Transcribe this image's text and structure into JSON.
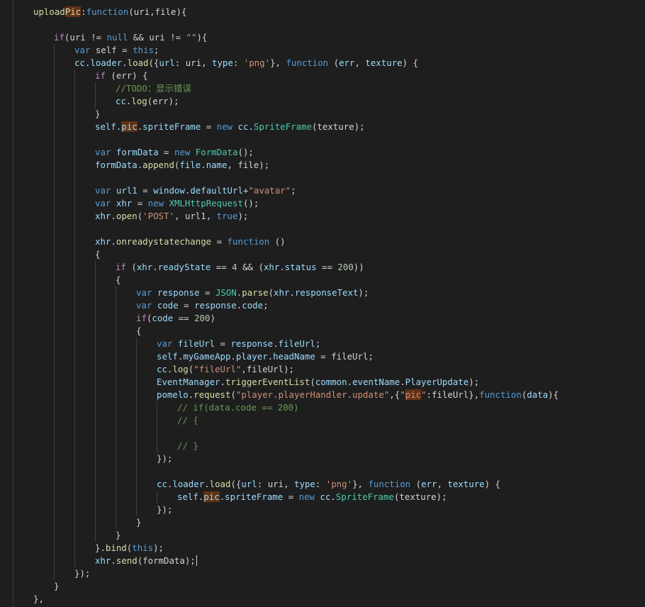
{
  "editor": {
    "theme_colors": {
      "background": "#1e1e1e",
      "keyword": "#569cd6",
      "control": "#c586c0",
      "function": "#dcdcaa",
      "string": "#ce9178",
      "number": "#b5cea8",
      "variable": "#9cdcfe",
      "type": "#4ec9b0",
      "comment": "#6a9955",
      "match_highlight": "#613214"
    },
    "current_line": 44,
    "lines": [
      [
        [
          "fn",
          "upload"
        ],
        [
          "fn hl",
          "Pic"
        ],
        [
          "pl",
          ":"
        ],
        [
          "kw",
          "function"
        ],
        [
          "pl",
          "(uri,file){"
        ]
      ],
      [],
      [
        [
          "ctl",
          "if"
        ],
        [
          "pl",
          "(uri != "
        ],
        [
          "kw",
          "null"
        ],
        [
          "pl",
          " && uri != "
        ],
        [
          "str",
          "\"\""
        ],
        [
          "pl",
          "){"
        ]
      ],
      [
        [
          "kw",
          "var"
        ],
        [
          "pl",
          " self = "
        ],
        [
          "kw",
          "this"
        ],
        [
          "pl",
          ";"
        ]
      ],
      [
        [
          "var",
          "cc"
        ],
        [
          "pl",
          "."
        ],
        [
          "var",
          "loader"
        ],
        [
          "pl",
          "."
        ],
        [
          "fn",
          "load"
        ],
        [
          "pl",
          "({"
        ],
        [
          "var",
          "url"
        ],
        [
          "pl",
          ": uri, "
        ],
        [
          "var",
          "type"
        ],
        [
          "pl",
          ": "
        ],
        [
          "str",
          "'png'"
        ],
        [
          "pl",
          "}, "
        ],
        [
          "kw",
          "function"
        ],
        [
          "pl",
          " ("
        ],
        [
          "var",
          "err"
        ],
        [
          "pl",
          ", "
        ],
        [
          "var",
          "texture"
        ],
        [
          "pl",
          ") {"
        ]
      ],
      [
        [
          "ctl",
          "if"
        ],
        [
          "pl",
          " (err) {"
        ]
      ],
      [
        [
          "cm",
          "//TODO：显示错误"
        ]
      ],
      [
        [
          "var",
          "cc"
        ],
        [
          "pl",
          "."
        ],
        [
          "fn",
          "log"
        ],
        [
          "pl",
          "(err);"
        ]
      ],
      [
        [
          "pl",
          "}"
        ]
      ],
      [
        [
          "var",
          "self"
        ],
        [
          "pl",
          "."
        ],
        [
          "var hl",
          "pic"
        ],
        [
          "pl",
          "."
        ],
        [
          "var",
          "spriteFrame"
        ],
        [
          "pl",
          " = "
        ],
        [
          "kw",
          "new"
        ],
        [
          "pl",
          " "
        ],
        [
          "var",
          "cc"
        ],
        [
          "pl",
          "."
        ],
        [
          "cls",
          "SpriteFrame"
        ],
        [
          "pl",
          "(texture);"
        ]
      ],
      [],
      [
        [
          "kw",
          "var"
        ],
        [
          "pl",
          " "
        ],
        [
          "var",
          "formData"
        ],
        [
          "pl",
          " = "
        ],
        [
          "kw",
          "new"
        ],
        [
          "pl",
          " "
        ],
        [
          "cls",
          "FormData"
        ],
        [
          "pl",
          "();"
        ]
      ],
      [
        [
          "var",
          "formData"
        ],
        [
          "pl",
          "."
        ],
        [
          "fn",
          "append"
        ],
        [
          "pl",
          "("
        ],
        [
          "var",
          "file"
        ],
        [
          "pl",
          "."
        ],
        [
          "var",
          "name"
        ],
        [
          "pl",
          ", file);"
        ]
      ],
      [],
      [
        [
          "kw",
          "var"
        ],
        [
          "pl",
          " "
        ],
        [
          "var",
          "url1"
        ],
        [
          "pl",
          " = "
        ],
        [
          "var",
          "window"
        ],
        [
          "pl",
          "."
        ],
        [
          "var",
          "defaultUrl"
        ],
        [
          "pl",
          "+"
        ],
        [
          "str",
          "\"avatar\""
        ],
        [
          "pl",
          ";"
        ]
      ],
      [
        [
          "kw",
          "var"
        ],
        [
          "pl",
          " "
        ],
        [
          "var",
          "xhr"
        ],
        [
          "pl",
          " = "
        ],
        [
          "kw",
          "new"
        ],
        [
          "pl",
          " "
        ],
        [
          "cls",
          "XMLHttpRequest"
        ],
        [
          "pl",
          "();"
        ]
      ],
      [
        [
          "var",
          "xhr"
        ],
        [
          "pl",
          "."
        ],
        [
          "fn",
          "open"
        ],
        [
          "pl",
          "("
        ],
        [
          "str",
          "'POST'"
        ],
        [
          "pl",
          ", url1, "
        ],
        [
          "kw",
          "true"
        ],
        [
          "pl",
          ");"
        ]
      ],
      [],
      [
        [
          "var",
          "xhr"
        ],
        [
          "pl",
          "."
        ],
        [
          "fn",
          "onreadystatechange"
        ],
        [
          "pl",
          " = "
        ],
        [
          "kw",
          "function"
        ],
        [
          "pl",
          " ()"
        ]
      ],
      [
        [
          "pl",
          "{"
        ]
      ],
      [
        [
          "ctl",
          "if"
        ],
        [
          "pl",
          " ("
        ],
        [
          "var",
          "xhr"
        ],
        [
          "pl",
          "."
        ],
        [
          "var",
          "readyState"
        ],
        [
          "pl",
          " == "
        ],
        [
          "num",
          "4"
        ],
        [
          "pl",
          " && ("
        ],
        [
          "var",
          "xhr"
        ],
        [
          "pl",
          "."
        ],
        [
          "var",
          "status"
        ],
        [
          "pl",
          " == "
        ],
        [
          "num",
          "200"
        ],
        [
          "pl",
          "))"
        ]
      ],
      [
        [
          "pl",
          "{"
        ]
      ],
      [
        [
          "kw",
          "var"
        ],
        [
          "pl",
          " "
        ],
        [
          "var",
          "response"
        ],
        [
          "pl",
          " = "
        ],
        [
          "cls",
          "JSON"
        ],
        [
          "pl",
          "."
        ],
        [
          "fn",
          "parse"
        ],
        [
          "pl",
          "("
        ],
        [
          "var",
          "xhr"
        ],
        [
          "pl",
          "."
        ],
        [
          "var",
          "responseText"
        ],
        [
          "pl",
          ");"
        ]
      ],
      [
        [
          "kw",
          "var"
        ],
        [
          "pl",
          " "
        ],
        [
          "var",
          "code"
        ],
        [
          "pl",
          " = "
        ],
        [
          "var",
          "response"
        ],
        [
          "pl",
          "."
        ],
        [
          "var",
          "code"
        ],
        [
          "pl",
          ";"
        ]
      ],
      [
        [
          "ctl",
          "if"
        ],
        [
          "pl",
          "("
        ],
        [
          "var",
          "code"
        ],
        [
          "pl",
          " == "
        ],
        [
          "num",
          "200"
        ],
        [
          "pl",
          ")"
        ]
      ],
      [
        [
          "pl",
          "{"
        ]
      ],
      [
        [
          "kw",
          "var"
        ],
        [
          "pl",
          " "
        ],
        [
          "var",
          "fileUrl"
        ],
        [
          "pl",
          " = "
        ],
        [
          "var",
          "response"
        ],
        [
          "pl",
          "."
        ],
        [
          "var",
          "fileUrl"
        ],
        [
          "pl",
          ";"
        ]
      ],
      [
        [
          "var",
          "self"
        ],
        [
          "pl",
          "."
        ],
        [
          "var",
          "myGameApp"
        ],
        [
          "pl",
          "."
        ],
        [
          "var",
          "player"
        ],
        [
          "pl",
          "."
        ],
        [
          "var",
          "headName"
        ],
        [
          "pl",
          " = fileUrl;"
        ]
      ],
      [
        [
          "var",
          "cc"
        ],
        [
          "pl",
          "."
        ],
        [
          "fn",
          "log"
        ],
        [
          "pl",
          "("
        ],
        [
          "str",
          "\"fileUrl\""
        ],
        [
          "pl",
          ",fileUrl);"
        ]
      ],
      [
        [
          "var",
          "EventManager"
        ],
        [
          "pl",
          "."
        ],
        [
          "fn",
          "triggerEventList"
        ],
        [
          "pl",
          "("
        ],
        [
          "var",
          "common"
        ],
        [
          "pl",
          "."
        ],
        [
          "var",
          "eventName"
        ],
        [
          "pl",
          "."
        ],
        [
          "var",
          "PlayerUpdate"
        ],
        [
          "pl",
          ");"
        ]
      ],
      [
        [
          "var",
          "pomelo"
        ],
        [
          "pl",
          "."
        ],
        [
          "fn",
          "request"
        ],
        [
          "pl",
          "("
        ],
        [
          "str",
          "\"player.playerHandler.update\""
        ],
        [
          "pl",
          ",{"
        ],
        [
          "str",
          "\""
        ],
        [
          "str hl",
          "pic"
        ],
        [
          "str",
          "\""
        ],
        [
          "pl",
          ":fileUrl},"
        ],
        [
          "kw",
          "function"
        ],
        [
          "pl",
          "("
        ],
        [
          "var",
          "data"
        ],
        [
          "pl",
          "){"
        ]
      ],
      [
        [
          "cm",
          "// if(data.code == 200)"
        ]
      ],
      [
        [
          "cm",
          "// {"
        ]
      ],
      [],
      [
        [
          "cm",
          "// }"
        ]
      ],
      [
        [
          "pl",
          "});"
        ]
      ],
      [],
      [
        [
          "var",
          "cc"
        ],
        [
          "pl",
          "."
        ],
        [
          "var",
          "loader"
        ],
        [
          "pl",
          "."
        ],
        [
          "fn",
          "load"
        ],
        [
          "pl",
          "({"
        ],
        [
          "var",
          "url"
        ],
        [
          "pl",
          ": uri, "
        ],
        [
          "var",
          "type"
        ],
        [
          "pl",
          ": "
        ],
        [
          "str",
          "'png'"
        ],
        [
          "pl",
          "}, "
        ],
        [
          "kw",
          "function"
        ],
        [
          "pl",
          " ("
        ],
        [
          "var",
          "err"
        ],
        [
          "pl",
          ", "
        ],
        [
          "var",
          "texture"
        ],
        [
          "pl",
          ") {"
        ]
      ],
      [
        [
          "var",
          "self"
        ],
        [
          "pl",
          "."
        ],
        [
          "var hl",
          "pic"
        ],
        [
          "pl",
          "."
        ],
        [
          "var",
          "spriteFrame"
        ],
        [
          "pl",
          " = "
        ],
        [
          "kw",
          "new"
        ],
        [
          "pl",
          " "
        ],
        [
          "var",
          "cc"
        ],
        [
          "pl",
          "."
        ],
        [
          "cls",
          "SpriteFrame"
        ],
        [
          "pl",
          "(texture);"
        ]
      ],
      [
        [
          "pl",
          "});"
        ]
      ],
      [
        [
          "pl",
          "}"
        ]
      ],
      [
        [
          "pl",
          "}"
        ]
      ],
      [
        [
          "pl",
          "}."
        ],
        [
          "fn",
          "bind"
        ],
        [
          "pl",
          "("
        ],
        [
          "kw",
          "this"
        ],
        [
          "pl",
          ");"
        ]
      ],
      [
        [
          "var",
          "xhr"
        ],
        [
          "pl",
          "."
        ],
        [
          "fn",
          "send"
        ],
        [
          "pl",
          "(formData);"
        ]
      ],
      [
        [
          "pl",
          "});"
        ]
      ],
      [
        [
          "pl",
          "}"
        ]
      ],
      [
        [
          "pl",
          "},"
        ]
      ]
    ]
  }
}
